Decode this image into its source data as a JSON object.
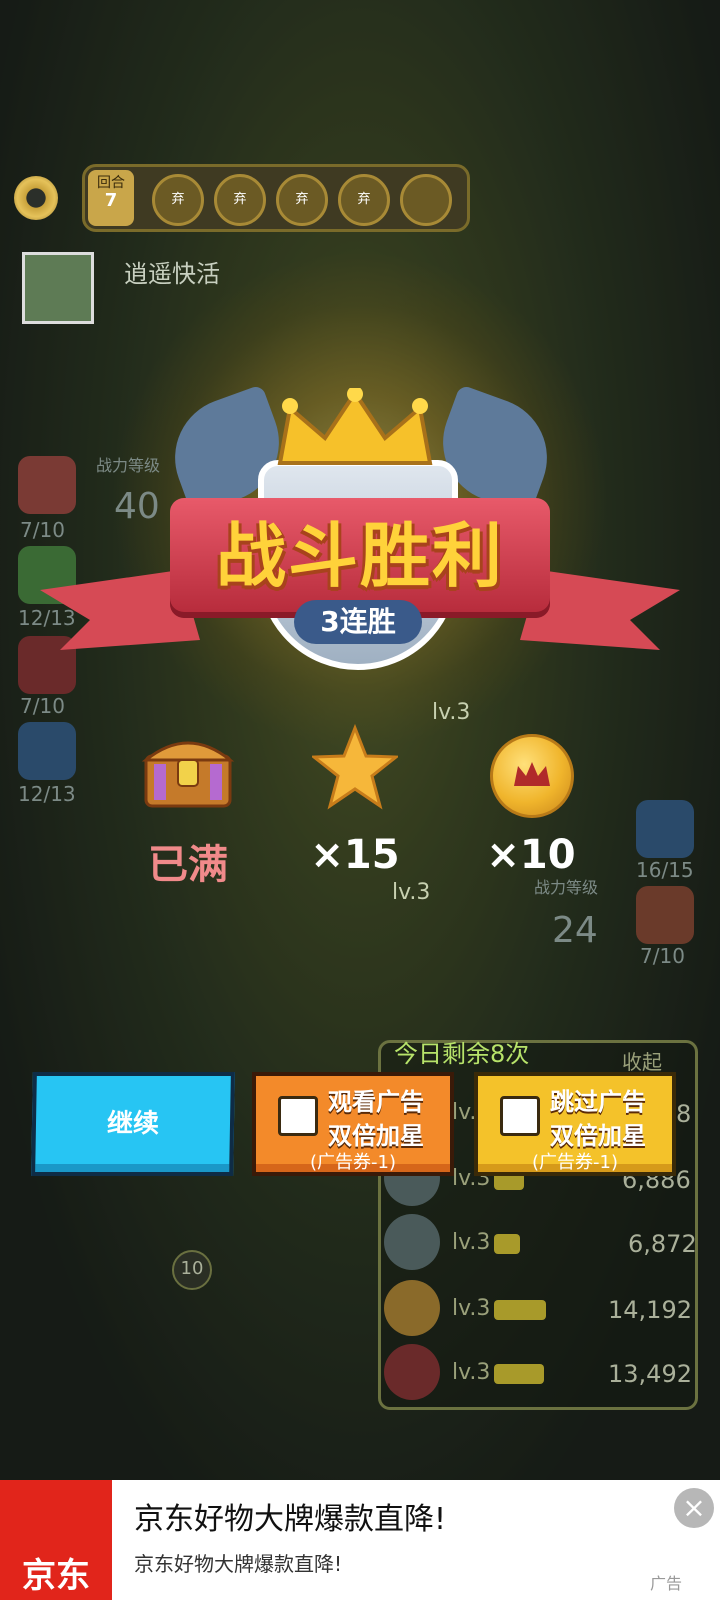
{
  "hud": {
    "round_label": "回合",
    "round_number": "7",
    "slots": [
      "弃",
      "弃",
      "弃",
      "弃",
      ""
    ],
    "player_name": "逍遥快活"
  },
  "left_units": [
    {
      "label": "战力等级",
      "value": "40"
    },
    {
      "count": "7/10"
    },
    {
      "count": "12/13"
    },
    {
      "count": "7/10"
    },
    {
      "count": "12/13"
    }
  ],
  "right_units": [
    {
      "count": "16/15"
    },
    {
      "label": "战力等级",
      "value": "24"
    },
    {
      "count": "7/10"
    }
  ],
  "victory": {
    "title": "战斗胜利",
    "streak": "3连胜"
  },
  "rewards": [
    {
      "icon": "treasure-chest-icon",
      "label": "已满"
    },
    {
      "icon": "star-icon",
      "label": "×15"
    },
    {
      "icon": "crown-coin-icon",
      "label": "×10"
    }
  ],
  "remaining_today": "今日剩余8次",
  "panel": {
    "collapse_label": "收起",
    "rows": [
      {
        "level": "lv.3",
        "value": "8"
      },
      {
        "level": "lv.3",
        "value": "6,886"
      },
      {
        "level": "lv.3",
        "value": "6,872"
      },
      {
        "level": "lv.3",
        "value": "14,192"
      },
      {
        "level": "lv.3",
        "value": "13,492"
      }
    ]
  },
  "battle_levels": [
    "lv.3",
    "lv.3"
  ],
  "counter_badge": "10",
  "buttons": {
    "continue": "继续",
    "watch_ad": {
      "line1": "观看广告",
      "line2": "双倍加星",
      "line3": "(广告券-1)"
    },
    "skip_ad": {
      "line1": "跳过广告",
      "line2": "双倍加星",
      "line3": "(广告券-1)"
    }
  },
  "ad": {
    "brand": "京东",
    "title": "京东好物大牌爆款直降!",
    "subtitle": "京东好物大牌爆款直降!",
    "tag": "广告"
  },
  "colors": {
    "continue_button": "#27c5f3",
    "watch_button": "#f38a2a",
    "skip_button": "#f4c22a",
    "title_gold": "#ffd23a",
    "ad_red": "#e1251b"
  }
}
